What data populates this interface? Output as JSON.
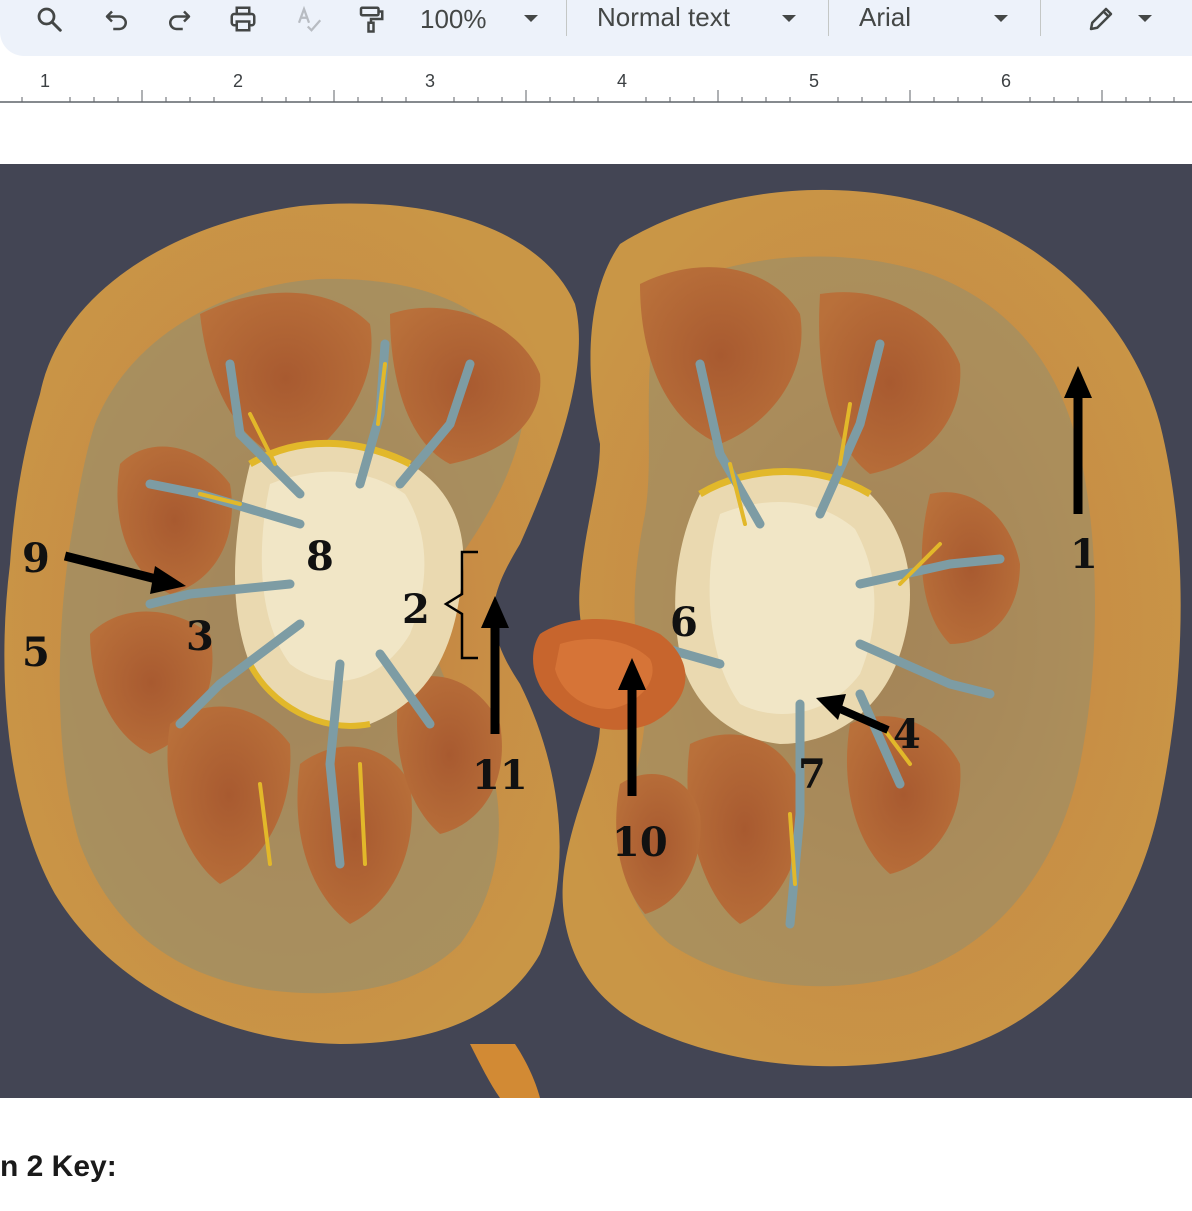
{
  "toolbar": {
    "icons": [
      "search-icon",
      "undo-icon",
      "redo-icon",
      "print-icon",
      "spellcheck-icon",
      "paint-format-icon",
      "edit-mode-icon"
    ],
    "zoom": "100%",
    "style_select": "Normal text",
    "font_select": "Arial"
  },
  "ruler": {
    "marks": [
      "1",
      "2",
      "3",
      "4",
      "5",
      "6"
    ]
  },
  "figure": {
    "labels": [
      "1",
      "2",
      "3",
      "4",
      "5",
      "6",
      "7",
      "8",
      "9",
      "10",
      "11"
    ]
  },
  "caption": "n 2 Key:"
}
